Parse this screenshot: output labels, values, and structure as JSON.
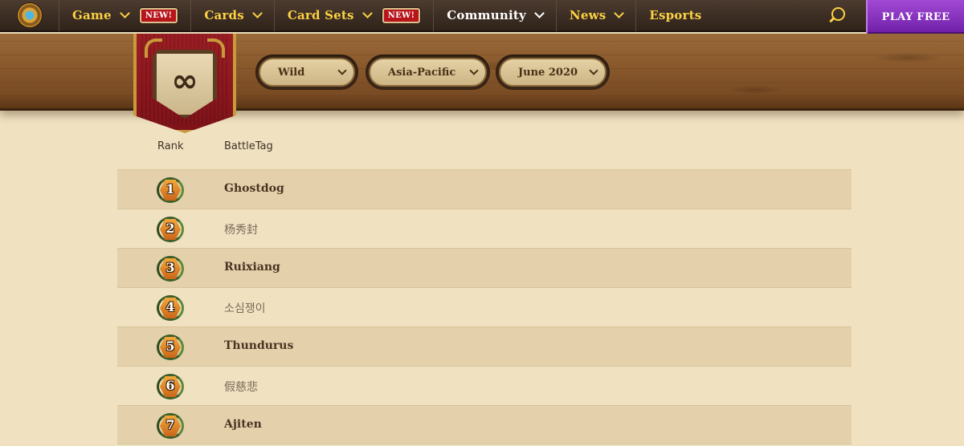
{
  "nav": {
    "items": [
      {
        "label": "Game",
        "dropdown": true,
        "new_badge": "NEW!"
      },
      {
        "label": "Cards",
        "dropdown": true
      },
      {
        "label": "Card Sets",
        "dropdown": true,
        "new_badge": "NEW!"
      },
      {
        "label": "Community",
        "dropdown": true
      },
      {
        "label": "News",
        "dropdown": true
      },
      {
        "label": "Esports",
        "dropdown": false
      }
    ],
    "play_button": "PLAY FREE",
    "icons": [
      "hearthstone-logo-icon",
      "search-icon"
    ]
  },
  "filters": [
    {
      "value": "Wild"
    },
    {
      "value": "Asia-Pacific"
    },
    {
      "value": "June 2020"
    }
  ],
  "emblem": {
    "icon": "infinity-icon",
    "glyph": "∞"
  },
  "table": {
    "headers": {
      "rank": "Rank",
      "battletag": "BattleTag"
    },
    "rows": [
      {
        "rank": "1",
        "battletag": "Ghostdog"
      },
      {
        "rank": "2",
        "battletag": "杨秀封"
      },
      {
        "rank": "3",
        "battletag": "Ruixiang"
      },
      {
        "rank": "4",
        "battletag": "소심쟁이"
      },
      {
        "rank": "5",
        "battletag": "Thundurus"
      },
      {
        "rank": "6",
        "battletag": "假慈悲"
      },
      {
        "rank": "7",
        "battletag": "Ajiten"
      }
    ]
  },
  "colors": {
    "nav_text": "#fcd144",
    "play_button": "#8a2fc4",
    "page_background": "#f0e2c1",
    "banner_red": "#9c1e24"
  }
}
